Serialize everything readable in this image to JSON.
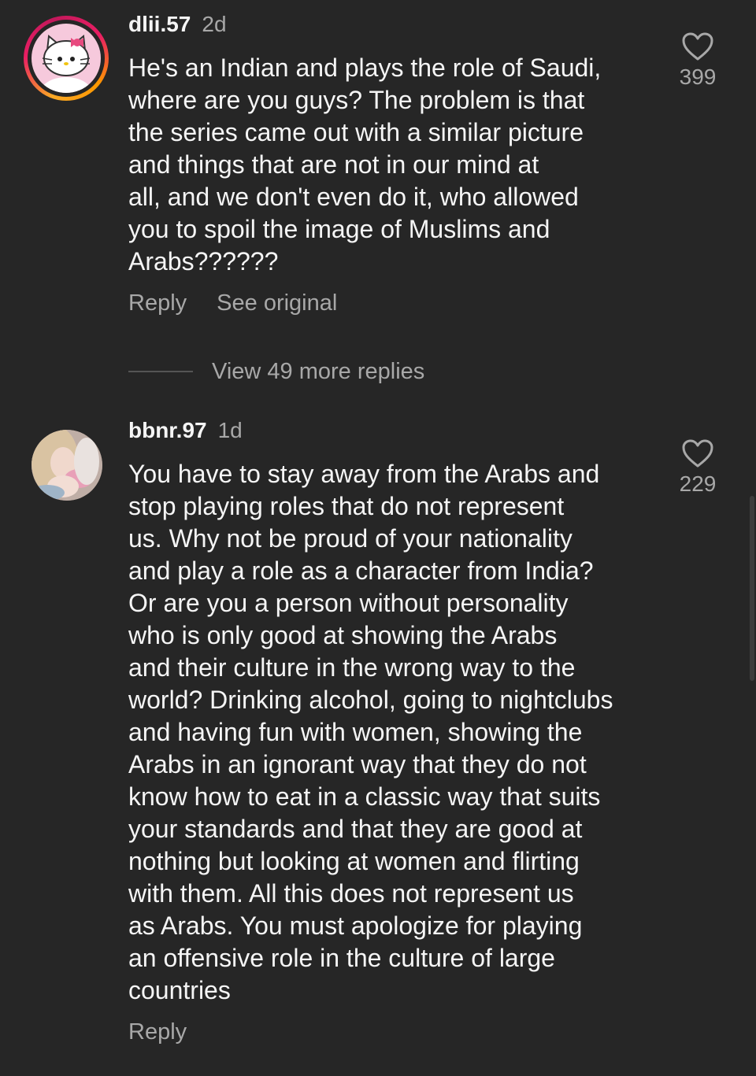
{
  "comments": [
    {
      "username": "dlii.57",
      "time": "2d",
      "avatar": "hello-kitty-avatar",
      "text": "He's an Indian and plays the role of Saudi,\nwhere are you guys? The problem is that\nthe series came out with a similar picture\nand things that are not in our mind at\nall, and we don't even do it, who allowed\nyou to spoil the image of Muslims and\nArabs??????",
      "likes": "399",
      "reply_label": "Reply",
      "see_original_label": "See original",
      "view_replies_label": "View 49 more replies"
    },
    {
      "username": "bbnr.97",
      "time": "1d",
      "avatar": "profile-photo-avatar",
      "text": "You have to stay away from the Arabs and\nstop playing roles that do not represent\nus. Why not be proud of your nationality\nand play a role as a character from India?\nOr are you a person without personality\nwho is only good at showing the Arabs\nand their culture in the wrong way to the\nworld? Drinking alcohol, going to nightclubs\nand having fun with women, showing the\nArabs in an ignorant way that they do not\nknow how to eat in a classic way that suits\nyour standards and that they are good at\nnothing but looking at women and flirting\nwith them. All this does not represent us\nas Arabs. You must apologize for playing\nan offensive role in the culture of large\ncountries",
      "likes": "229",
      "reply_label": "Reply"
    }
  ],
  "colors": {
    "background": "#262626",
    "primary_text": "#f5f5f5",
    "secondary_text": "#a8a8a8"
  }
}
